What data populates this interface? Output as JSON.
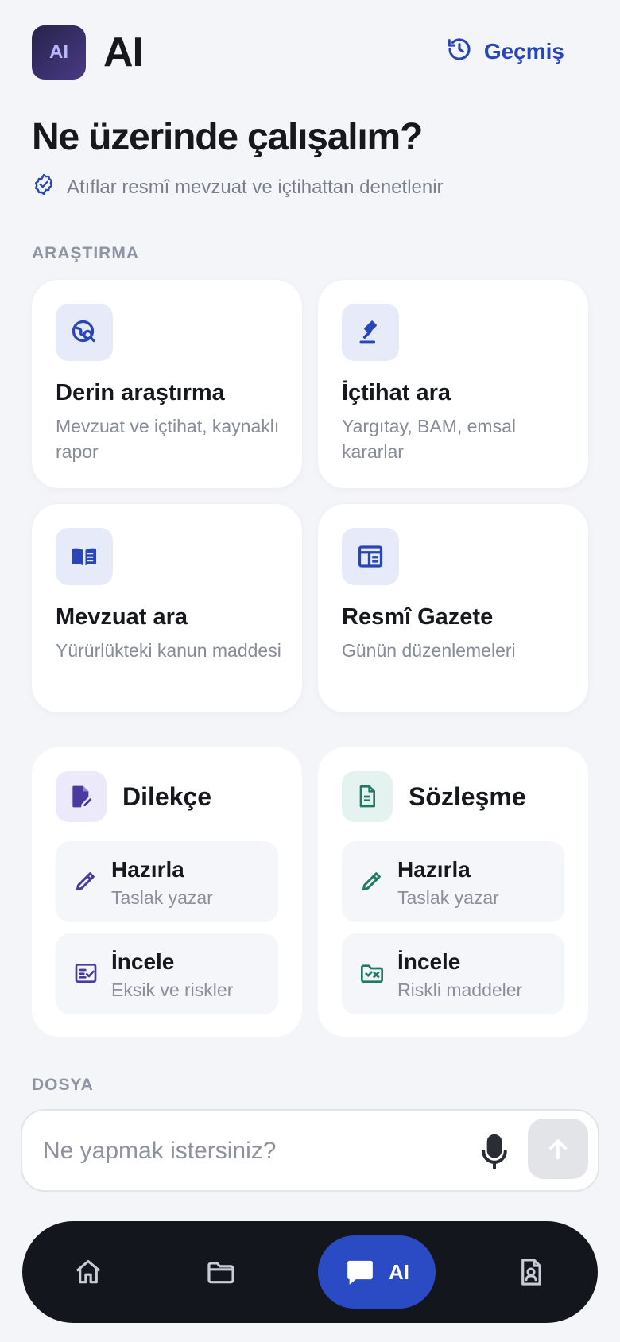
{
  "header": {
    "logo_text": "AI",
    "app_title": "AI",
    "history_label": "Geçmiş"
  },
  "headline": "Ne üzerinde çalışalım?",
  "subline": "Atıflar resmî mevzuat ve içtihattan denetlenir",
  "sections": {
    "research": "ARAŞTIRMA",
    "file": "DOSYA"
  },
  "research_cards": [
    {
      "title": "Derin araştırma",
      "desc": "Mevzuat ve içtihat, kaynaklı rapor",
      "icon": "globe-search-icon"
    },
    {
      "title": "İçtihat ara",
      "desc": "Yargıtay, BAM, emsal kararlar",
      "icon": "gavel-icon"
    },
    {
      "title": "Mevzuat ara",
      "desc": "Yürürlükteki kanun maddesi",
      "icon": "open-book-icon"
    },
    {
      "title": "Resmî Gazete",
      "desc": "Günün düzenlemeleri",
      "icon": "newspaper-icon"
    }
  ],
  "groups": [
    {
      "title": "Dilekçe",
      "accent": "#4b3a9e",
      "icon_bg": "#ece9fb",
      "actions": [
        {
          "title": "Hazırla",
          "desc": "Taslak yazar",
          "icon": "pencil-icon"
        },
        {
          "title": "İncele",
          "desc": "Eksik ve riskler",
          "icon": "checklist-icon"
        }
      ]
    },
    {
      "title": "Sözleşme",
      "accent": "#1f7a66",
      "icon_bg": "#e4f3ef",
      "actions": [
        {
          "title": "Hazırla",
          "desc": "Taslak yazar",
          "icon": "pencil-icon"
        },
        {
          "title": "İncele",
          "desc": "Riskli maddeler",
          "icon": "folder-x-icon"
        }
      ]
    }
  ],
  "composer": {
    "placeholder": "Ne yapmak istersiniz?",
    "value": ""
  },
  "nav": {
    "ai_label": "AI",
    "items": [
      "home-icon",
      "folder-icon",
      "chat-icon",
      "contact-card-icon"
    ]
  },
  "colors": {
    "accent": "#2b4bc4",
    "background": "#f4f5f8",
    "nav_bg": "#13161d"
  }
}
